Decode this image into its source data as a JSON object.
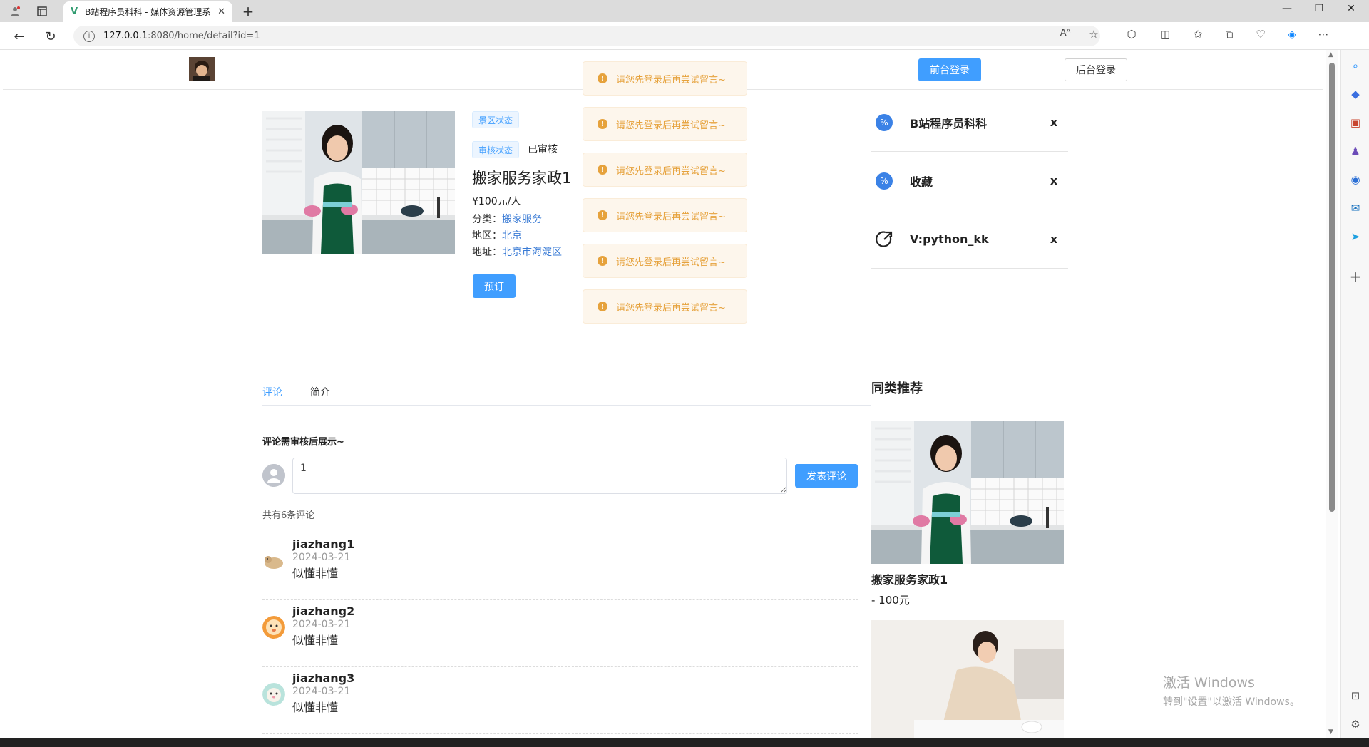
{
  "browser": {
    "tab_title": "B站程序员科科 - 媒体资源管理系",
    "url_host": "127.0.0.1",
    "url_rest": ":8080/home/detail?id=1"
  },
  "header": {
    "front_login": "前台登录",
    "back_login": "后台登录"
  },
  "product": {
    "tag_scenic_status": "景区状态",
    "tag_review_status": "审核状态",
    "review_status_value": "已审核",
    "title": "搬家服务家政1",
    "price": "¥100元/人",
    "category_label": "分类：",
    "category_value": "搬家服务",
    "region_label": "地区：",
    "region_value": "北京",
    "address_label": "地址：",
    "address_value": "北京市海淀区",
    "book_button": "预订"
  },
  "toasts": [
    "请您先登录后再尝试留言~",
    "请您先登录后再尝试留言~",
    "请您先登录后再尝试留言~",
    "请您先登录后再尝试留言~",
    "请您先登录后再尝试留言~",
    "请您先登录后再尝试留言~"
  ],
  "links": [
    {
      "label": "B站程序员科科",
      "close": "x"
    },
    {
      "label": "收藏",
      "close": "x"
    },
    {
      "label": "V:python_kk",
      "close": "x"
    }
  ],
  "tabs": {
    "comment": "评论",
    "intro": "简介"
  },
  "comment_form": {
    "hint": "评论需审核后展示~",
    "input_value": "1",
    "post_button": "发表评论",
    "count_text": "共有6条评论"
  },
  "comments": [
    {
      "user": "jiazhang1",
      "date": "2024-03-21",
      "text": "似懂非懂"
    },
    {
      "user": "jiazhang2",
      "date": "2024-03-21",
      "text": "似懂非懂"
    },
    {
      "user": "jiazhang3",
      "date": "2024-03-21",
      "text": "似懂非懂"
    }
  ],
  "recommend": {
    "title": "同类推荐",
    "item_name": "搬家服务家政1",
    "item_price": "- 100元"
  },
  "watermark": {
    "line1": "激活 Windows",
    "line2": "转到\"设置\"以激活 Windows。"
  },
  "colors": {
    "primary": "#409eff",
    "warning": "#e6a23c",
    "warning_bg": "#fdf6ec"
  }
}
